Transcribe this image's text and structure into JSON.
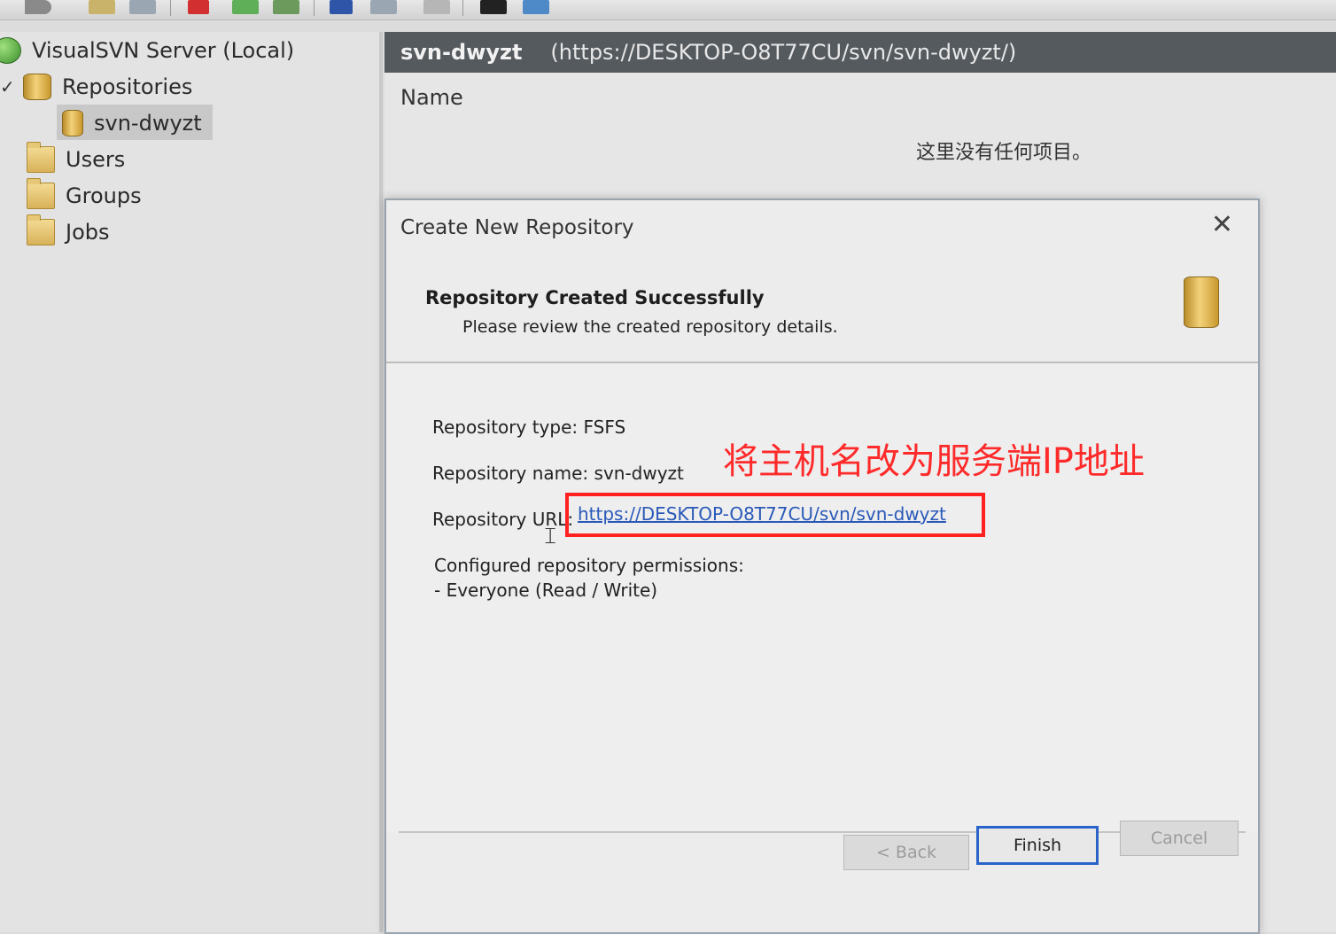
{
  "tree": {
    "root": "VisualSVN Server (Local)",
    "repositories": "Repositories",
    "repo_item": "svn-dwyzt",
    "users": "Users",
    "groups": "Groups",
    "jobs": "Jobs"
  },
  "content": {
    "header_name": "svn-dwyzt",
    "header_url": "(https://DESKTOP-O8T77CU/svn/svn-dwyzt/)",
    "column_name": "Name",
    "empty_message": "这里没有任何项目。"
  },
  "dialog": {
    "title": "Create New Repository",
    "close_symbol": "✕",
    "heading": "Repository Created Successfully",
    "subheading": "Please review the created repository details.",
    "type_label": "Repository type: FSFS",
    "name_label": "Repository name: svn-dwyzt",
    "url_label": "Repository URL:",
    "url_value": "https://DESKTOP-O8T77CU/svn/svn-dwyzt",
    "permissions_label": "Configured repository permissions:",
    "permissions_value": "- Everyone (Read / Write)",
    "annotation": "将主机名改为服务端IP地址",
    "buttons": {
      "back": "< Back",
      "finish": "Finish",
      "cancel": "Cancel"
    }
  },
  "icons": {
    "server": "globe-icon",
    "repository": "repository-db-icon",
    "folder": "folder-icon",
    "close": "close-icon"
  },
  "colors": {
    "header_bg": "#555a5f",
    "link": "#2a59b8",
    "annotation": "#ff2a2a",
    "primary_button_border": "#2a64c8"
  }
}
